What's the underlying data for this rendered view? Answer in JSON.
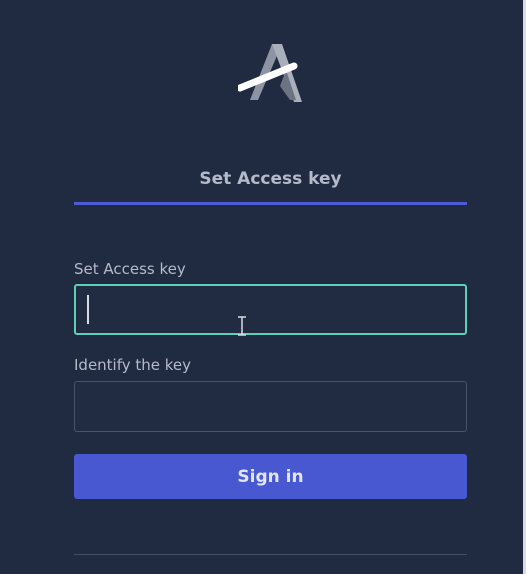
{
  "tab": {
    "label": "Set Access key"
  },
  "form": {
    "access_key": {
      "label": "Set Access key",
      "value": ""
    },
    "identify_key": {
      "label": "Identify the key",
      "value": ""
    },
    "submit_label": "Sign in"
  },
  "colors": {
    "background": "#202a41",
    "accent": "#4758d1",
    "focus_border": "#5dd0b7",
    "tab_underline": "#4e5bd6"
  },
  "icons": {
    "logo": "app-logo-a",
    "cursor": "text-cursor-icon"
  }
}
